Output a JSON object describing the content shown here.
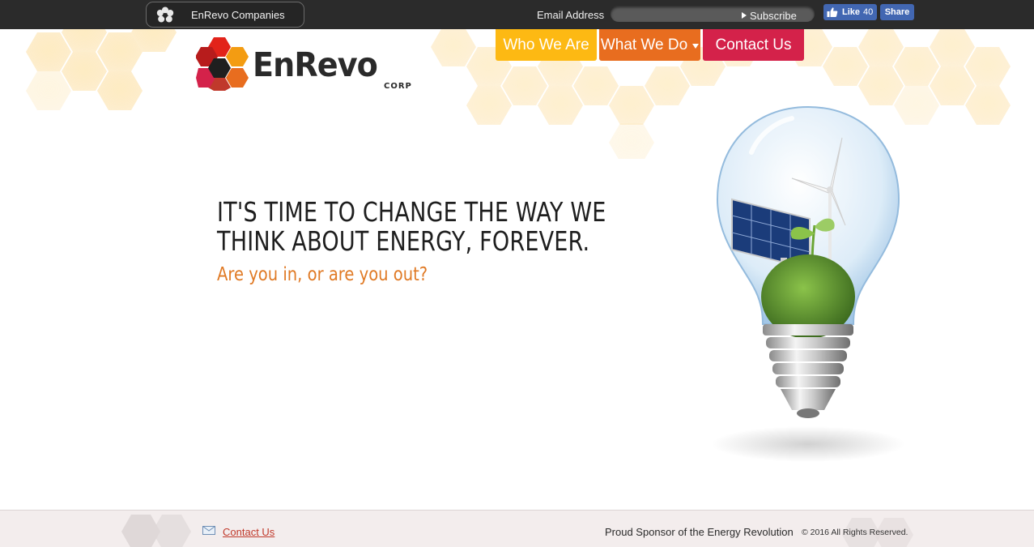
{
  "topbar": {
    "companies_label": "EnRevo Companies",
    "email_label": "Email Address",
    "email_placeholder": "",
    "subscribe_label": "Subscribe",
    "fb_like_label": "Like",
    "fb_like_count": "40",
    "fb_share_label": "Share"
  },
  "logo": {
    "wordmark": "EnRevo",
    "sub": "CORP"
  },
  "nav": {
    "tabs": [
      {
        "label": "Who We Are",
        "color": "#fdb913"
      },
      {
        "label": "What We Do",
        "color": "#e86d1f",
        "has_dropdown": true
      },
      {
        "label": "Contact Us",
        "color": "#d4224a"
      }
    ]
  },
  "hero": {
    "headline_line1": "IT'S TIME TO CHANGE THE WAY WE",
    "headline_line2": "THINK ABOUT ENERGY, FOREVER.",
    "subhead": "Are you in, or are you out?"
  },
  "footer": {
    "contact_label": "Contact Us",
    "sponsor_text": "Proud Sponsor of the Energy Revolution",
    "copyright": "© 2016 All Rights Reserved."
  },
  "colors": {
    "topbar_bg": "#2b2b2b",
    "accent_yellow": "#fdb913",
    "accent_orange": "#e86d1f",
    "accent_red": "#d4224a",
    "subhead_orange": "#e07a25",
    "footer_bg": "#f3eded"
  },
  "icons": [
    "flower-icon",
    "play-arrow-icon",
    "thumbs-up-icon",
    "mail-icon",
    "caret-down-icon",
    "logo-hex-mark",
    "lightbulb-illustration"
  ]
}
